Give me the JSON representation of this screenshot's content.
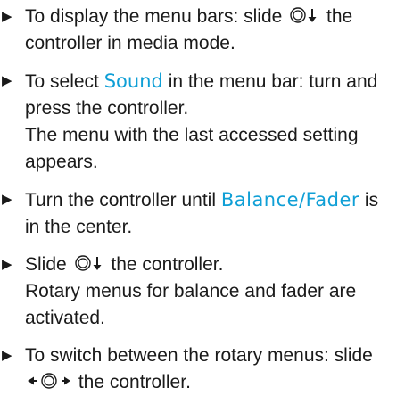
{
  "marker_glyph": "▶",
  "icons": {
    "controller_down": "controller-slide-down-icon",
    "controller_left_right": "controller-slide-left-right-icon"
  },
  "steps": [
    {
      "line1_before": "To display the menu bars: slide ",
      "line1_after": " the",
      "line2": "controller in media mode."
    },
    {
      "line1_before": "To select ",
      "highlight": "Sound",
      "line1_after": " in the menu bar: turn and",
      "line2": "press the controller.",
      "line3": "The menu with the last accessed setting",
      "line4": "appears."
    },
    {
      "line1_before": "Turn the controller until ",
      "highlight": "Balance/Fader",
      "line1_after": " is",
      "line2": "in the center."
    },
    {
      "line1_before": "Slide ",
      "line1_after": " the controller.",
      "line2": "Rotary menus for balance and fader are",
      "line3": "activated."
    },
    {
      "line1_before": "To switch between the rotary menus: slide",
      "line2_after": " the controller."
    }
  ]
}
